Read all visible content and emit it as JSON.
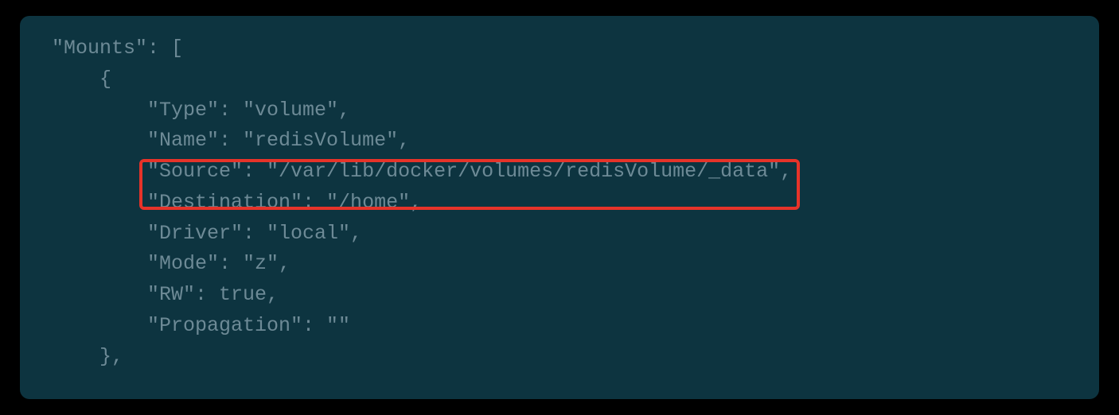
{
  "code": {
    "line1": "\"Mounts\": [",
    "line2": "    {",
    "line3": "        \"Type\": \"volume\",",
    "line4": "        \"Name\": \"redisVolume\",",
    "line5": "        \"Source\": \"/var/lib/docker/volumes/redisVolume/_data\",",
    "line6": "        \"Destination\": \"/home\",",
    "line7": "        \"Driver\": \"local\",",
    "line8": "        \"Mode\": \"z\",",
    "line9": "        \"RW\": true,",
    "line10": "        \"Propagation\": \"\"",
    "line11": "    },"
  }
}
